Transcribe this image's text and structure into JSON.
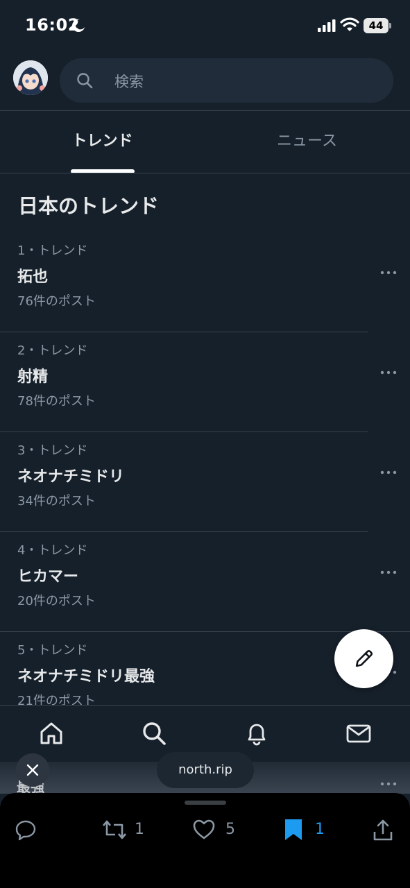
{
  "status_bar": {
    "time": "16:02",
    "battery": "44",
    "icons": [
      "moon-icon",
      "signal-icon",
      "wifi-icon",
      "battery-icon"
    ]
  },
  "header": {
    "search_placeholder": "検索"
  },
  "tabs": [
    {
      "label": "トレンド",
      "active": true
    },
    {
      "label": "ニュース",
      "active": false
    }
  ],
  "section_title": "日本のトレンド",
  "trends": [
    {
      "meta": "1・トレンド",
      "name": "拓也",
      "count": "76件のポスト"
    },
    {
      "meta": "2・トレンド",
      "name": "射精",
      "count": "78件のポスト"
    },
    {
      "meta": "3・トレンド",
      "name": "ネオナチミドリ",
      "count": "34件のポスト"
    },
    {
      "meta": "4・トレンド",
      "name": "ヒカマー",
      "count": "20件のポスト"
    },
    {
      "meta": "5・トレンド",
      "name": "ネオナチミドリ最強",
      "count": "21件のポスト"
    }
  ],
  "bottom_nav": [
    "home-icon",
    "search-icon",
    "bell-icon",
    "mail-icon"
  ],
  "overlay": {
    "url": "north.rip",
    "partial_text": "最強"
  },
  "actions": {
    "retweets": "1",
    "likes": "5",
    "bookmarks": "1"
  },
  "colors": {
    "background": "#16202b",
    "accent": "#1d9bf0",
    "muted": "#8b98a5"
  }
}
